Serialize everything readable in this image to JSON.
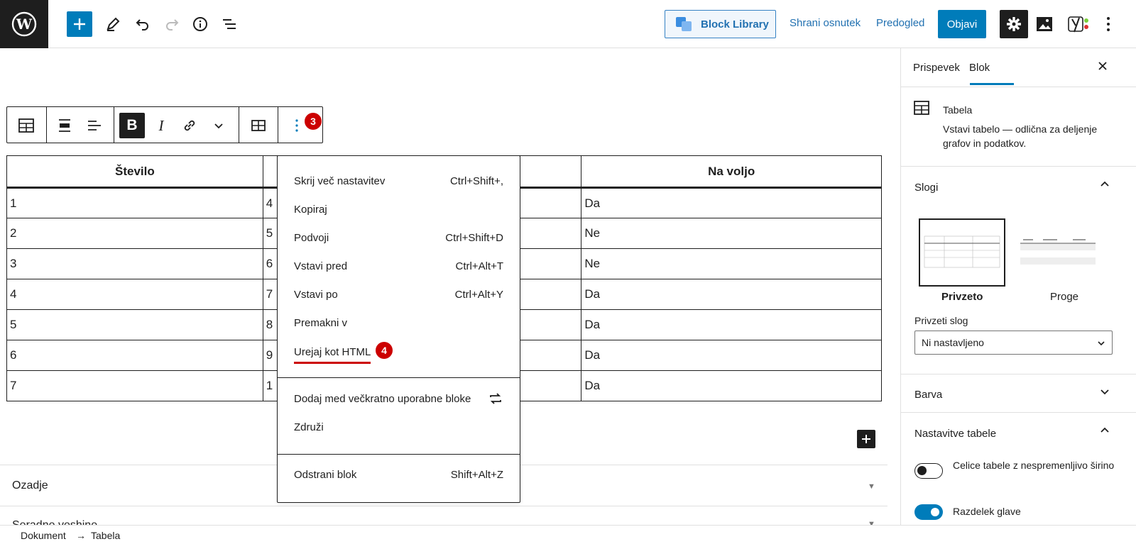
{
  "topbar": {
    "block_library_label": "Block Library",
    "save_draft": "Shrani osnutek",
    "preview": "Predogled",
    "publish": "Objavi"
  },
  "colors": {
    "accent": "#007cba",
    "badge": "#cc0000",
    "dark": "#1e1e1e"
  },
  "block_toolbar": {
    "more_badge": "3",
    "icons": [
      "table-icon",
      "align-wide-icon",
      "align-left-icon",
      "bold-icon",
      "italic-icon",
      "link-icon",
      "chevron-down-icon",
      "table-edit-icon",
      "more-vertical-icon"
    ]
  },
  "table": {
    "headers": [
      "Število",
      "",
      "Na voljo"
    ],
    "rows": [
      [
        "1",
        "4",
        "Da"
      ],
      [
        "2",
        "5",
        "Ne"
      ],
      [
        "3",
        "6",
        "Ne"
      ],
      [
        "4",
        "7",
        "Da"
      ],
      [
        "5",
        "8",
        "Da"
      ],
      [
        "6",
        "9",
        "Da"
      ],
      [
        "7",
        "1",
        "Da"
      ]
    ]
  },
  "menu": {
    "items": [
      {
        "label": "Skrij več nastavitev",
        "shortcut": "Ctrl+Shift+,"
      },
      {
        "label": "Kopiraj",
        "shortcut": ""
      },
      {
        "label": "Podvoji",
        "shortcut": "Ctrl+Shift+D"
      },
      {
        "label": "Vstavi pred",
        "shortcut": "Ctrl+Alt+T"
      },
      {
        "label": "Vstavi po",
        "shortcut": "Ctrl+Alt+Y"
      },
      {
        "label": "Premakni v",
        "shortcut": ""
      },
      {
        "label": "Urejaj kot HTML",
        "shortcut": ""
      }
    ],
    "html_badge": "4",
    "reusable": "Dodaj med večkratno uporabne bloke",
    "group": "Združi",
    "remove": {
      "label": "Odstrani blok",
      "shortcut": "Shift+Alt+Z"
    }
  },
  "sections": {
    "background": "Ozadje",
    "second_cut": "Seradne veshine"
  },
  "sidebar": {
    "tabs": [
      "Prispevek",
      "Blok"
    ],
    "active_tab": "Blok",
    "block_name": "Tabela",
    "block_desc": "Vstavi tabelo — odlična za deljenje grafov in podatkov.",
    "styles_title": "Slogi",
    "style_options": [
      "Privzeto",
      "Proge"
    ],
    "default_style_label": "Privzeti slog",
    "default_style_value": "Ni nastavljeno",
    "color_title": "Barva",
    "table_settings_title": "Nastavitve tabele",
    "fixed_width_label": "Celice tabele z nespremenljivo širino",
    "fixed_width_on": false,
    "header_label": "Razdelek glave",
    "header_on": true
  },
  "footer": {
    "breadcrumb": [
      "Dokument",
      "Tabela"
    ],
    "arrow": "→"
  }
}
